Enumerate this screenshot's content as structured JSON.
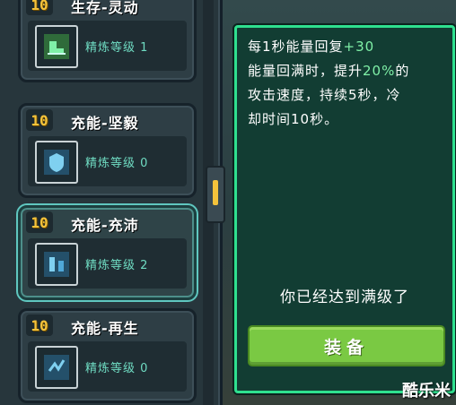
{
  "talents": [
    {
      "level": "10",
      "title": "生存-灵动",
      "rank_label": "精炼等级",
      "rank": "1",
      "icon": "boot-icon",
      "selected": false
    },
    {
      "level": "10",
      "title": "充能-坚毅",
      "rank_label": "精炼等级",
      "rank": "0",
      "icon": "shield-chip-icon",
      "selected": false
    },
    {
      "level": "10",
      "title": "充能-充沛",
      "rank_label": "精炼等级",
      "rank": "2",
      "icon": "energy-chip-icon",
      "selected": true
    },
    {
      "level": "10",
      "title": "充能-再生",
      "rank_label": "精炼等级",
      "rank": "0",
      "icon": "regen-chip-icon",
      "selected": false
    }
  ],
  "detail": {
    "line1_a": "每1秒能量回复",
    "line1_b": "+30",
    "line2_a": "能量回满时，提升",
    "line2_b": "20%",
    "line2_c": "的",
    "line3": "攻击速度，持续5秒，冷",
    "line4": "却时间10秒。",
    "maxed": "你已经达到满级了",
    "equip_label": "装备"
  },
  "watermark": "酷乐米",
  "colors": {
    "accent": "#2fe08f",
    "level": "#f5c33b",
    "rank": "#6fdbc2",
    "button": "#7ac943"
  }
}
